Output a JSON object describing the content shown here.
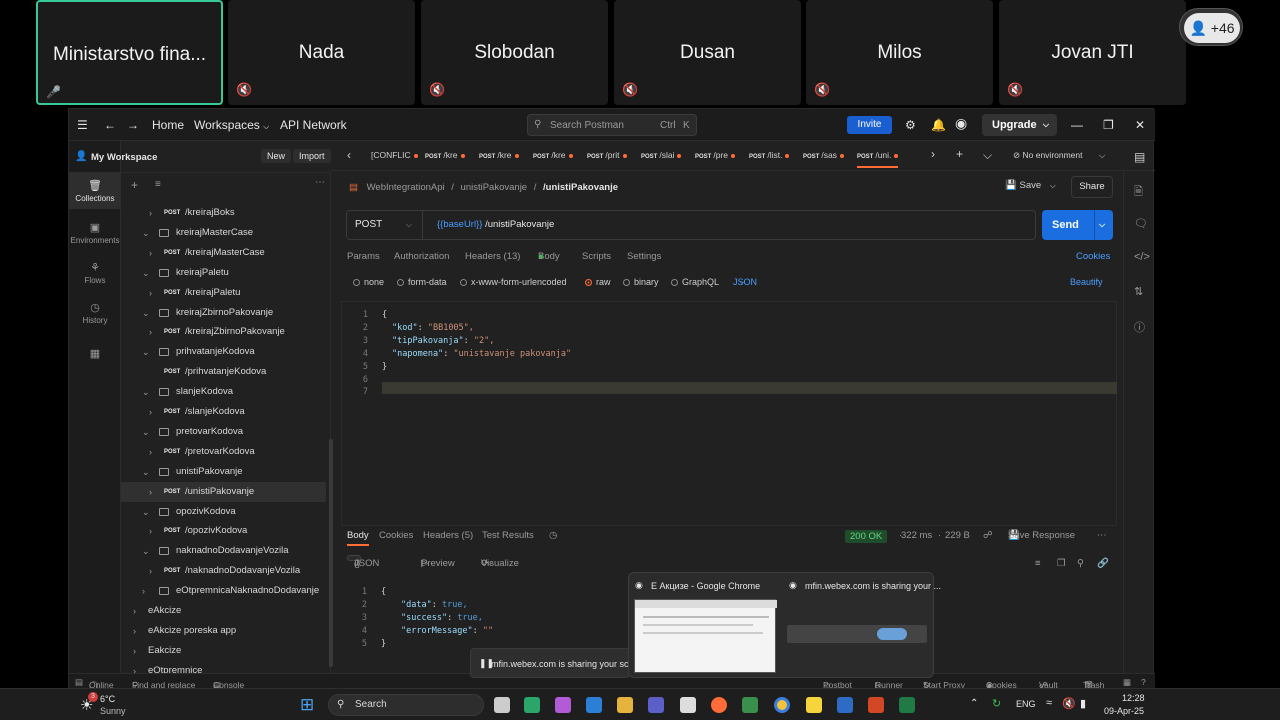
{
  "participants": {
    "tiles": [
      {
        "name": "Ministarstvo fina..."
      },
      {
        "name": "Nada"
      },
      {
        "name": "Slobodan"
      },
      {
        "name": "Dusan"
      },
      {
        "name": "Milos"
      },
      {
        "name": "Jovan JTI"
      }
    ],
    "more_count": "+46"
  },
  "topbar": {
    "home": "Home",
    "workspaces": "Workspaces",
    "api_network": "API Network",
    "search_placeholder": "Search Postman",
    "search_shortcut_1": "Ctrl",
    "search_shortcut_2": "K",
    "invite": "Invite",
    "upgrade": "Upgrade"
  },
  "sidebar": {
    "workspace_title": "My Workspace",
    "new_label": "New",
    "import_label": "Import",
    "rail": [
      {
        "label": "Collections",
        "icon": "collections-icon"
      },
      {
        "label": "Environments",
        "icon": "environments-icon"
      },
      {
        "label": "Flows",
        "icon": "flows-icon"
      },
      {
        "label": "History",
        "icon": "history-icon"
      },
      {
        "label": "",
        "icon": "configure-icon"
      }
    ],
    "method_label": "POST",
    "tree": [
      {
        "type": "request",
        "label": "/kreirajBoks"
      },
      {
        "type": "folder",
        "label": "kreirajMasterCase"
      },
      {
        "type": "request",
        "label": "/kreirajMasterCase"
      },
      {
        "type": "folder",
        "label": "kreirajPaletu"
      },
      {
        "type": "request",
        "label": "/kreirajPaletu"
      },
      {
        "type": "folder",
        "label": "kreirajZbirnoPakovanje"
      },
      {
        "type": "request",
        "label": "/kreirajZbirnoPakovanje"
      },
      {
        "type": "folder",
        "label": "prihvatanjeKodova"
      },
      {
        "type": "request-leaf",
        "label": "/prihvatanjeKodova"
      },
      {
        "type": "folder",
        "label": "slanjeKodova"
      },
      {
        "type": "request",
        "label": "/slanjeKodova"
      },
      {
        "type": "folder",
        "label": "pretovarKodova"
      },
      {
        "type": "request",
        "label": "/pretovarKodova"
      },
      {
        "type": "folder",
        "label": "unistiPakovanje"
      },
      {
        "type": "request-selected",
        "label": "/unistiPakovanje"
      },
      {
        "type": "folder",
        "label": "opozivKodova"
      },
      {
        "type": "request",
        "label": "/opozivKodova"
      },
      {
        "type": "folder",
        "label": "naknadnoDodavanjeVozila"
      },
      {
        "type": "request",
        "label": "/naknadnoDodavanjeVozila"
      },
      {
        "type": "folder-closed",
        "label": "eOtpremnicaNaknadnoDodavanje"
      },
      {
        "type": "collection",
        "label": "eAkcize"
      },
      {
        "type": "collection",
        "label": "eAkcize poreska app"
      },
      {
        "type": "collection",
        "label": "Eakcize"
      },
      {
        "type": "collection",
        "label": "eOtpremnice"
      }
    ]
  },
  "tabs": {
    "items": [
      {
        "method": "",
        "label": "[CONFLIC"
      },
      {
        "method": "POST",
        "label": "/kre"
      },
      {
        "method": "POST",
        "label": "/kre"
      },
      {
        "method": "POST",
        "label": "/kre"
      },
      {
        "method": "POST",
        "label": "/prit"
      },
      {
        "method": "POST",
        "label": "/slai"
      },
      {
        "method": "POST",
        "label": "/pre"
      },
      {
        "method": "POST",
        "label": "/list."
      },
      {
        "method": "POST",
        "label": "/sas"
      },
      {
        "method": "POST",
        "label": "/uni."
      }
    ],
    "environment": "No environment"
  },
  "request": {
    "breadcrumb_1": "WebIntegrationApi",
    "breadcrumb_2": "unistiPakovanje",
    "breadcrumb_current": "/unistiPakovanje",
    "save_label": "Save",
    "share_label": "Share",
    "method": "POST",
    "url_var": "{{baseUrl}}",
    "url_path": " /unistiPakovanje",
    "send_label": "Send",
    "subtabs": {
      "params": "Params",
      "authorization": "Authorization",
      "headers": "Headers (13)",
      "body": "Body",
      "scripts": "Scripts",
      "settings": "Settings",
      "cookies": "Cookies"
    },
    "body_types": {
      "none": "none",
      "form_data": "form-data",
      "urlencoded": "x-www-form-urlencoded",
      "raw": "raw",
      "binary": "binary",
      "graphql": "GraphQL",
      "format": "JSON",
      "beautify": "Beautify"
    },
    "body_lines": [
      {
        "n": "1",
        "text": "{"
      },
      {
        "n": "2",
        "key": "\"kod\"",
        "val": "\"BB1005\","
      },
      {
        "n": "3",
        "key": "\"tipPakovanja\"",
        "val": "\"2\","
      },
      {
        "n": "4",
        "key": "\"napomena\"",
        "val": "\"unistavanje pakovanja\""
      },
      {
        "n": "5",
        "text": "}"
      },
      {
        "n": "6",
        "text": ""
      },
      {
        "n": "7",
        "text": ""
      }
    ]
  },
  "response": {
    "tabs": {
      "body": "Body",
      "cookies": "Cookies",
      "headers": "Headers (5)",
      "test_results": "Test Results"
    },
    "status": "200 OK",
    "time": "322 ms",
    "size": "229 B",
    "save_response": "Save Response",
    "format": "JSON",
    "preview": "Preview",
    "visualize": "Visualize",
    "lines": [
      {
        "n": "1",
        "text": "{"
      },
      {
        "n": "2",
        "key": "\"data\"",
        "val": "true,"
      },
      {
        "n": "3",
        "key": "\"success\"",
        "val": "true,"
      },
      {
        "n": "4",
        "key": "\"errorMessage\"",
        "val": "\"\""
      },
      {
        "n": "5",
        "text": "}"
      }
    ]
  },
  "statusbar": {
    "online": "Online",
    "find_replace": "Find and replace",
    "console": "Console",
    "postbot": "Postbot",
    "runner": "Runner",
    "start_proxy": "Start Proxy",
    "cookies": "Cookies",
    "vault": "Vault",
    "trash": "Trash"
  },
  "popups": {
    "thumb_1_title": "Е Акцизе - Google Chrome",
    "thumb_2_title": "mfin.webex.com is sharing your ...",
    "share_bar": "mfin.webex.com is sharing your scre"
  },
  "taskbar": {
    "weather_temp": "6°C",
    "weather_desc": "Sunny",
    "weather_badge": "3",
    "search": "Search",
    "lang": "ENG",
    "time": "12:28",
    "date": "09-Apr-25"
  }
}
